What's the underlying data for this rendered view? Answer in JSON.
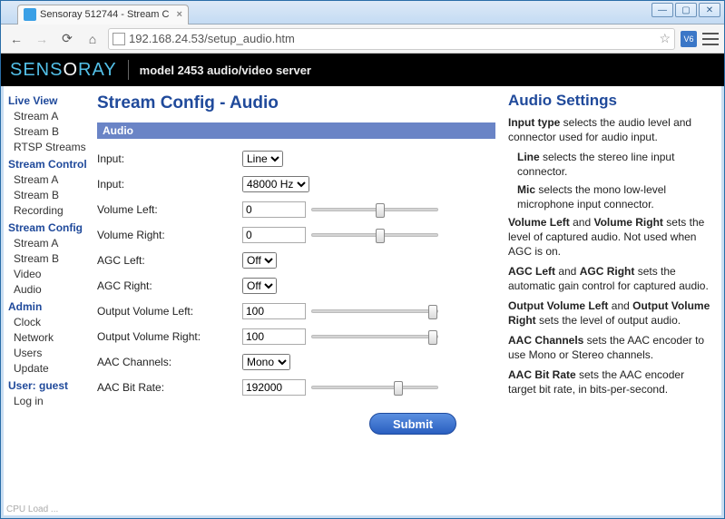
{
  "browser": {
    "tab_title": "Sensoray 512744 - Stream C",
    "url": "192.168.24.53/setup_audio.htm"
  },
  "header": {
    "logo_a": "SENS",
    "logo_b": "RAY",
    "subtitle": "model 2453 audio/video server"
  },
  "sidebar": {
    "groups": [
      {
        "head": "Live View",
        "items": [
          "Stream A",
          "Stream B",
          "RTSP Streams"
        ]
      },
      {
        "head": "Stream Control",
        "items": [
          "Stream A",
          "Stream B",
          "Recording"
        ]
      },
      {
        "head": "Stream Config",
        "items": [
          "Stream A",
          "Stream B",
          "Video",
          "Audio"
        ]
      },
      {
        "head": "Admin",
        "items": [
          "Clock",
          "Network",
          "Users",
          "Update"
        ]
      },
      {
        "head": "User: guest",
        "items": [
          "Log in"
        ]
      }
    ]
  },
  "main": {
    "title": "Stream Config - Audio",
    "section": "Audio",
    "rows": [
      {
        "label": "Input:",
        "type": "select",
        "value": "Line"
      },
      {
        "label": "Input:",
        "type": "select",
        "value": "48000 Hz"
      },
      {
        "label": "Volume Left:",
        "type": "text_slider",
        "value": "0",
        "pos": 55
      },
      {
        "label": "Volume Right:",
        "type": "text_slider",
        "value": "0",
        "pos": 55
      },
      {
        "label": "AGC Left:",
        "type": "select",
        "value": "Off"
      },
      {
        "label": "AGC Right:",
        "type": "select",
        "value": "Off"
      },
      {
        "label": "Output Volume Left:",
        "type": "text_slider",
        "value": "100",
        "pos": 100
      },
      {
        "label": "Output Volume Right:",
        "type": "text_slider",
        "value": "100",
        "pos": 100
      },
      {
        "label": "AAC Channels:",
        "type": "select",
        "value": "Mono"
      },
      {
        "label": "AAC Bit Rate:",
        "type": "text_slider",
        "value": "192000",
        "pos": 70
      }
    ],
    "submit": "Submit"
  },
  "help": {
    "title": "Audio Settings",
    "p1a": "Input type",
    "p1b": " selects the audio level and connector used for audio input.",
    "p2a": "Line",
    "p2b": " selects the stereo line input connector.",
    "p3a": "Mic",
    "p3b": " selects the mono low-level microphone input connector.",
    "p4a": "Volume Left",
    "p4m": " and ",
    "p4b": "Volume Right",
    "p4c": " sets the level of captured audio. Not used when AGC is on.",
    "p5a": "AGC Left",
    "p5m": " and ",
    "p5b": "AGC Right",
    "p5c": " sets the automatic gain control for captured audio.",
    "p6a": "Output Volume Left",
    "p6m": " and ",
    "p6b": "Output Volume Right",
    "p6c": " sets the level of output audio.",
    "p7a": "AAC Channels",
    "p7b": " sets the AAC encoder to use Mono or Stereo channels.",
    "p8a": "AAC Bit Rate",
    "p8b": " sets the AAC encoder target bit rate, in bits-per-second."
  },
  "status": "CPU Load ..."
}
